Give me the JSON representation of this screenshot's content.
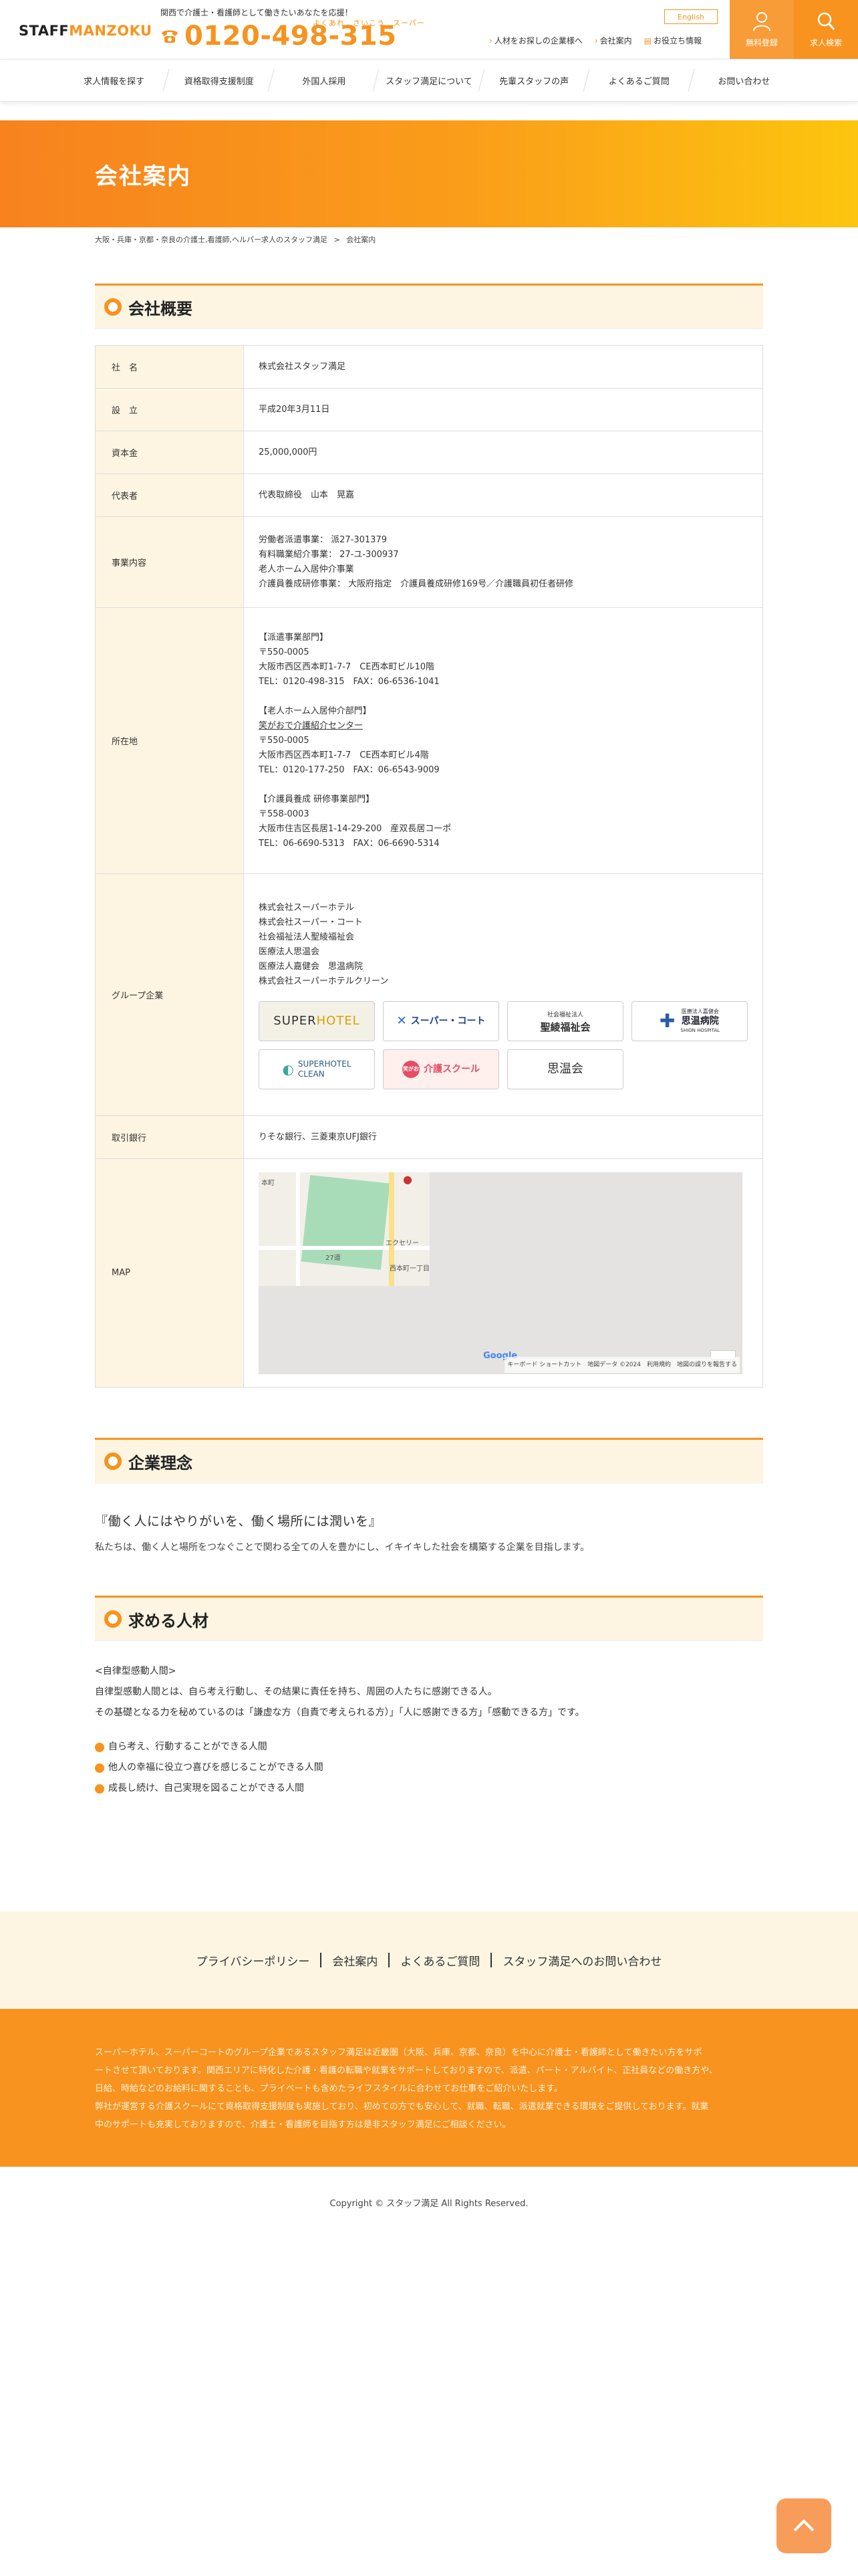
{
  "header": {
    "logo_part1": "STAFF",
    "logo_part2": "MANZOKU",
    "tagline": "関西で介護士・看護師として働きたいあなたを応援！",
    "phone": "0120-498-315",
    "phone_ruby": "よくあれ　さいこう　スーパー",
    "english_label": "English",
    "links": [
      "人材をお探しの企業様へ",
      "会社案内",
      "お役立ち情報"
    ],
    "register_label": "無料登録",
    "jobsearch_label": "求人検索"
  },
  "nav": [
    "求人情報を探す",
    "資格取得支援制度",
    "外国人採用",
    "スタッフ満足について",
    "先輩スタッフの声",
    "よくあるご質問",
    "お問い合わせ"
  ],
  "hero": {
    "title": "会社案内"
  },
  "breadcrumb": {
    "parent": "大阪・兵庫・京都・奈良の介護士,看護師,ヘルパー求人のスタッフ満足",
    "sep": ">",
    "current": "会社案内"
  },
  "overview": {
    "heading": "会社概要",
    "rows": {
      "name": {
        "label": "社　名",
        "value": "株式会社スタッフ満足"
      },
      "founded": {
        "label": "設　立",
        "value": "平成20年3月11日"
      },
      "capital": {
        "label": "資本金",
        "value": "25,000,000円"
      },
      "rep": {
        "label": "代表者",
        "value": "代表取締役　山本　晃嘉"
      },
      "business": {
        "label": "事業内容",
        "lines": [
          "労働者派遣事業： 派27-301379",
          "有料職業紹介事業： 27-ユ-300937",
          "老人ホーム入居仲介事業",
          "介護員養成研修事業： 大阪府指定　介護員養成研修169号／介護職員初任者研修"
        ]
      },
      "address": {
        "label": "所在地",
        "dispatch": [
          "【派遣事業部門】",
          "〒550-0005",
          "大阪市西区西本町1-7-7　CE西本町ビル10階",
          "TEL：0120-498-315　FAX：06-6536-1041"
        ],
        "nursing_head": "【老人ホーム入居仲介部門】",
        "nursing_link": "笑がおで介護紹介センター",
        "nursing": [
          "〒550-0005",
          "大阪市西区西本町1-7-7　CE西本町ビル4階",
          "TEL：0120-177-250　FAX：06-6543-9009"
        ],
        "training": [
          "【介護員養成 研修事業部門】",
          "〒558-0003",
          "大阪市住吉区長居1-14-29-200　産双長居コーポ",
          "TEL：06-6690-5313　FAX：06-6690-5314"
        ]
      },
      "group": {
        "label": "グループ企業",
        "companies": [
          "株式会社スーパーホテル",
          "株式会社スーパー・コート",
          "社会福祉法人聖綾福祉会",
          "医療法人思温会",
          "医療法人嘉健会　思温病院",
          "株式会社スーパーホテルクリーン"
        ],
        "logos": {
          "superhotel_a": "SUPER",
          "superhotel_b": "HOTEL",
          "supercourt": "スーパー・コート",
          "seiryo_small": "社会福祉法人",
          "seiryo": "聖綾福祉会",
          "shion_small": "医療法人嘉健会",
          "shion": "思温病院",
          "shion_en": "SHION HOSPITAL",
          "shclean_1": "SUPERHOTEL",
          "shclean_2": "CLEAN",
          "kaigo": "介護スクール",
          "kaigo_badge": "笑がお",
          "onsenkai": "思温会"
        }
      },
      "bank": {
        "label": "取引銀行",
        "value": "りそな銀行、三菱東京UFJ銀行"
      },
      "map": {
        "label": "MAP",
        "google": "Google",
        "footer": "キーボード ショートカット　地図データ ©2024　利用規約　地図の誤りを報告する",
        "labels": [
          "西本町一丁目",
          "27道",
          "本町",
          "エクセリー"
        ]
      }
    }
  },
  "philosophy": {
    "heading": "企業理念",
    "quote": "『働く人にはやりがいを、働く場所には潤いを』",
    "text": "私たちは、働く人と場所をつなぐことで関わる全ての人を豊かにし、イキイキした社会を構築する企業を目指します。"
  },
  "talent": {
    "heading": "求める人材",
    "lines": [
      "<自律型感動人間>",
      "自律型感動人間とは、自ら考え行動し、その結果に責任を持ち、周囲の人たちに感謝できる人。",
      "その基礎となる力を秘めているのは「謙虚な方（自責で考えられる方）」「人に感謝できる方」「感動できる方」です。"
    ],
    "bullets": [
      "自ら考え、行動することができる人間",
      "他人の幸福に役立つ喜びを感じることができる人間",
      "成長し続け、自己実現を図ることができる人間"
    ]
  },
  "footer": {
    "links": [
      "プライバシーポリシー",
      "会社案内",
      "よくあるご質問",
      "スタッフ満足へのお問い合わせ"
    ],
    "about_lines": [
      "スーパーホテル、スーパーコートのグループ企業であるスタッフ満足は近畿圏（大阪、兵庫、京都、奈良）を中心に介護士・看護師として働きたい方をサポ",
      "ートさせて頂いております。関西エリアに特化した介護・看護の転職や就業をサポートしておりますので、派遣、パート・アルバイト、正社員などの働き方や、",
      "日給、時給などのお給料に関することも、プライベートも含めたライフスタイルに合わせてお仕事をご紹介いたします。",
      "弊社が運営する介護スクールにて資格取得支援制度も実施しており、初めての方でも安心して、就職、転職、派遣就業できる環境をご提供しております。就業",
      "中のサポートも充実しておりますので、介護士・看護師を目指す方は是非スタッフ満足にご相談ください。"
    ],
    "copyright": "Copyright © スタッフ満足 All Rights Reserved."
  },
  "colors": {
    "accent": "#f7931e",
    "cream": "#fdf5e2",
    "hero_end": "#fcc50e"
  }
}
